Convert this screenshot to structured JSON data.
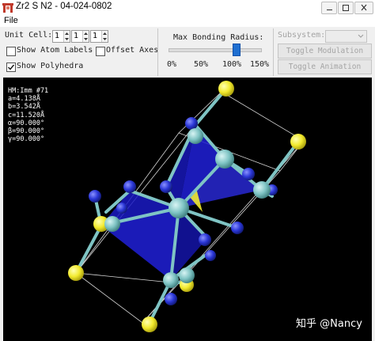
{
  "window": {
    "title": "Zr2 S N2 - 04-024-0802"
  },
  "menu": {
    "file": "File"
  },
  "toolbar": {
    "unit_cell_label": "Unit Cell:",
    "unit_cell_values": [
      "1",
      "1",
      "1"
    ],
    "show_atom_labels": "Show Atom Labels",
    "show_atom_labels_checked": false,
    "offset_axes": "Offset Axes",
    "offset_axes_checked": false,
    "show_polyhedra": "Show Polyhedra",
    "show_polyhedra_checked": true,
    "bonding_label": "Max Bonding Radius:",
    "bonding_ticks": [
      "0%",
      "50%",
      "100%",
      "150%"
    ],
    "bonding_value_percent": 112,
    "subsystem_label": "Subsystem:",
    "subsystem_value": "",
    "toggle_modulation": "Toggle Modulation",
    "toggle_animation": "Toggle Animation"
  },
  "structure_info": {
    "hm": "HM:Imm #71",
    "a": "a=4.138Å",
    "b": "b=3.542Å",
    "c": "c=11.520Å",
    "alpha": "α=90.000°",
    "beta": "β=90.000°",
    "gamma": "γ=90.000°"
  },
  "watermark": "知乎 @Nancy",
  "colors": {
    "zr_atom": "#7fc4c4",
    "s_atom": "#f2ea2e",
    "n_atom": "#2a36d6",
    "polyhedra": "#2020d8",
    "background": "#000000",
    "slider_thumb": "#1f6fd1"
  }
}
